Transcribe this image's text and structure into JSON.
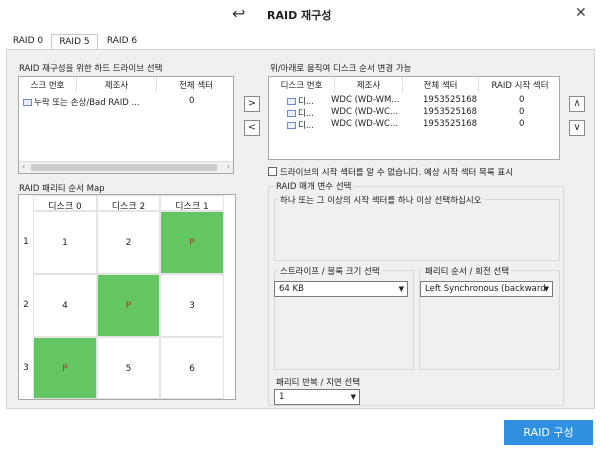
{
  "window": {
    "title": "RAID 재구성",
    "back_glyph": "↩",
    "close_glyph": "✕"
  },
  "tabs": [
    {
      "label": "RAID 0",
      "active": false
    },
    {
      "label": "RAID 5",
      "active": true
    },
    {
      "label": "RAID 6",
      "active": false
    }
  ],
  "left_list": {
    "title": "RAID 재구성을 위한 하드 드라이브 선택",
    "columns": [
      "스크 번호",
      "제조사",
      "전체 섹터"
    ],
    "rows": [
      {
        "disk": "누락 또는 손상/Bad RAID ...",
        "maker": "",
        "sectors": "0"
      }
    ]
  },
  "move_buttons": {
    "right": ">",
    "left": "<"
  },
  "right_list": {
    "title": "위/아래로 움직여 디스크 순서 변경 가능",
    "columns": [
      "디스크 번호",
      "제조사",
      "전체 섹터",
      "RAID 시작 섹터"
    ],
    "rows": [
      {
        "disk": "디...",
        "maker": "WDC (WD-WM...",
        "sectors": "1953525168",
        "start": "0"
      },
      {
        "disk": "디...",
        "maker": "WDC (WD-WC...",
        "sectors": "1953525168",
        "start": "0"
      },
      {
        "disk": "디...",
        "maker": "WDC (WD-WC...",
        "sectors": "1953525168",
        "start": "0"
      }
    ]
  },
  "order_buttons": {
    "up": "∧",
    "down": "∨"
  },
  "unknown_start": {
    "label": "드라이브의 시작 섹터를 알 수 없습니다. 예상 시작 섹터 목록 표시",
    "checked": false
  },
  "parity_map": {
    "title": "RAID 패리티 순서 Map",
    "columns": [
      "디스크 0",
      "디스크 2",
      "디스크 1"
    ],
    "rows": [
      {
        "num": "1",
        "cells": [
          "1",
          "2",
          "P"
        ]
      },
      {
        "num": "2",
        "cells": [
          "4",
          "P",
          "3"
        ]
      },
      {
        "num": "3",
        "cells": [
          "P",
          "5",
          "6"
        ]
      }
    ],
    "parity_color": "#63c663"
  },
  "raid_params": {
    "title": "RAID 매개 변수 선택",
    "hint": "하나 또는 그 이상의 시작 섹터를 하나 이상 선택하십시오",
    "stripe_label": "스트라이프 / 블록 크기 선택",
    "stripe_value": "64 KB",
    "parity_label": "패리티 순서 / 회전 선택",
    "parity_value": "Left Synchronous (backward",
    "delay_label": "패리티 반복 / 지연 선택",
    "delay_value": "1"
  },
  "primary_button": {
    "label": "RAID 구성",
    "color": "#2f8fe0"
  }
}
